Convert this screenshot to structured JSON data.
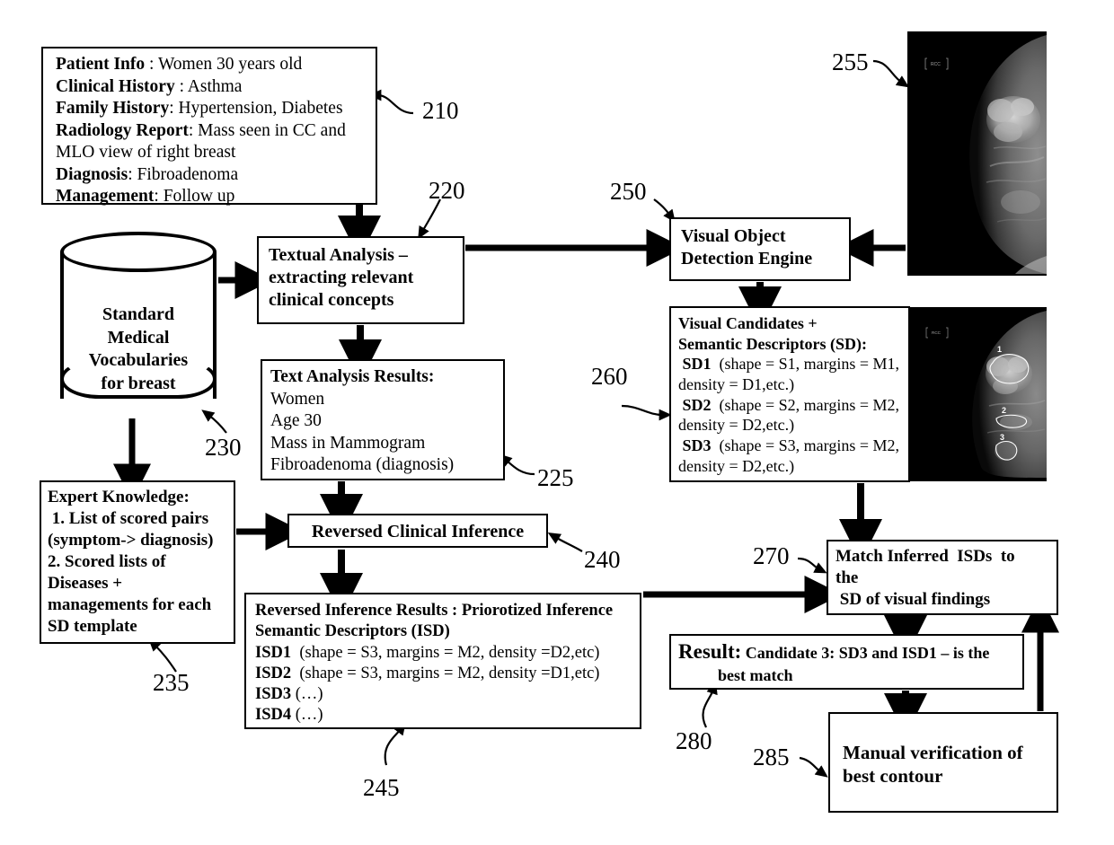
{
  "diagram": {
    "patient_info": {
      "lines": [
        {
          "label": "Patient Info",
          "value": " : Women 30 years old"
        },
        {
          "label": "Clinical History",
          "value": " : Asthma"
        },
        {
          "label": "Family History",
          "value": ": Hypertension, Diabetes"
        },
        {
          "label": "Radiology Report",
          "value": ": Mass seen in CC and"
        },
        {
          "label": "",
          "value": "MLO view of right breast"
        },
        {
          "label": "Diagnosis",
          "value": ": Fibroadenoma"
        },
        {
          "label": "Management",
          "value": ": Follow up"
        }
      ]
    },
    "vocabulary_cylinder": {
      "line1": "Standard",
      "line2": "Medical",
      "line3": "Vocabularies",
      "line4": "for breast"
    },
    "textual_analysis": {
      "line1": "Textual Analysis –",
      "line2": "extracting relevant",
      "line3": "clinical concepts"
    },
    "text_analysis_results": {
      "title": "Text Analysis Results:",
      "items": [
        "Women",
        "Age 30",
        "Mass in Mammogram",
        "Fibroadenoma (diagnosis)"
      ]
    },
    "expert_knowledge": {
      "title": "Expert Knowledge:",
      "lines": [
        " 1. List of scored pairs",
        "(symptom-> diagnosis)",
        "2. Scored lists of",
        "Diseases +",
        "managements for each",
        "SD template"
      ]
    },
    "reversed_clinical_inference": {
      "label": "Reversed Clinical Inference"
    },
    "inference_results": {
      "title_line1": "Reversed Inference Results : Priorotized Inference",
      "title_line2": "Semantic Descriptors (ISD)",
      "items": [
        {
          "key": "ISD1",
          "value": "  (shape = S3, margins = M2, density =D2,etc)"
        },
        {
          "key": "ISD2",
          "value": "  (shape = S3, margins = M2, density =D1,etc)"
        },
        {
          "key": "ISD3",
          "value": " (…)"
        },
        {
          "key": "ISD4",
          "value": " (…)"
        }
      ]
    },
    "visual_object_detection": {
      "line1": "Visual Object",
      "line2": "Detection Engine"
    },
    "visual_candidates": {
      "title_line1": "Visual Candidates +",
      "title_line2": "Semantic Descriptors (SD):",
      "items": [
        {
          "key": " SD1",
          "value": "  (shape = S1, margins = M1,",
          "cont": "density = D1,etc.)"
        },
        {
          "key": " SD2",
          "value": "  (shape = S2, margins = M2,",
          "cont": "density = D2,etc.)"
        },
        {
          "key": " SD3",
          "value": "  (shape = S3, margins = M2,",
          "cont": "density = D2,etc.)"
        }
      ]
    },
    "match_box": {
      "line1": "Match Inferred  ISDs  to",
      "line2": "the",
      "line3": " SD of visual findings"
    },
    "result_box": {
      "prefix": "Result:",
      "line1": " Candidate 3: SD3 and ISD1 – is the",
      "line2": "best match"
    },
    "manual_verification": {
      "line1": "Manual verification of",
      "line2": "best contour"
    },
    "mammograms": {
      "top": {
        "tag": "RCC"
      },
      "bottom": {
        "tag": "RCC",
        "candidate_labels": [
          "1",
          "2",
          "3"
        ]
      }
    },
    "reference_numerals": [
      {
        "id": "210",
        "label": "210"
      },
      {
        "id": "220",
        "label": "220"
      },
      {
        "id": "225",
        "label": "225"
      },
      {
        "id": "230",
        "label": "230"
      },
      {
        "id": "235",
        "label": "235"
      },
      {
        "id": "240",
        "label": "240"
      },
      {
        "id": "245",
        "label": "245"
      },
      {
        "id": "250",
        "label": "250"
      },
      {
        "id": "255",
        "label": "255"
      },
      {
        "id": "260",
        "label": "260"
      },
      {
        "id": "270",
        "label": "270"
      },
      {
        "id": "280",
        "label": "280"
      },
      {
        "id": "285",
        "label": "285"
      }
    ],
    "colors": {
      "ink": "#000000",
      "paper": "#ffffff",
      "image_bg": "#000000"
    }
  }
}
